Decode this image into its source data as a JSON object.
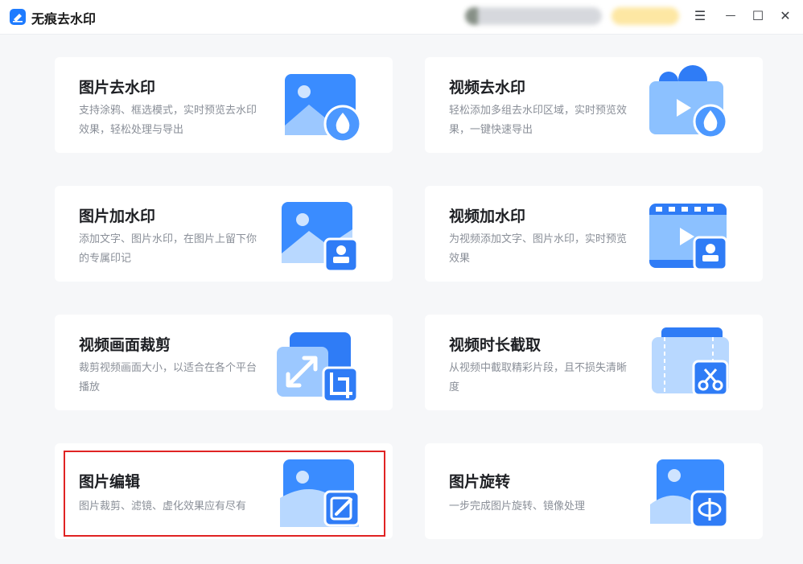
{
  "app": {
    "title": "无痕去水印"
  },
  "window": {
    "menu_glyph": "☰",
    "min_glyph": "—",
    "max_glyph": "☐",
    "close_glyph": "✕"
  },
  "colors": {
    "accent": "#1e7bff",
    "highlight": "#e02323"
  },
  "cards": [
    {
      "title": "图片去水印",
      "desc": "支持涂鸦、框选模式，实时预览去水印效果，轻松处理与导出",
      "icon": "image-drop-icon"
    },
    {
      "title": "视频去水印",
      "desc": "轻松添加多组去水印区域，实时预览效果，一键快速导出",
      "icon": "video-drop-icon"
    },
    {
      "title": "图片加水印",
      "desc": "添加文字、图片水印，在图片上留下你的专属印记",
      "icon": "image-stamp-icon"
    },
    {
      "title": "视频加水印",
      "desc": "为视频添加文字、图片水印，实时预览效果",
      "icon": "video-stamp-icon"
    },
    {
      "title": "视频画面裁剪",
      "desc": "裁剪视频画面大小，以适合在各个平台播放",
      "icon": "video-crop-icon"
    },
    {
      "title": "视频时长截取",
      "desc": "从视频中截取精彩片段，且不损失清晰度",
      "icon": "video-cut-icon"
    },
    {
      "title": "图片编辑",
      "desc": "图片裁剪、滤镜、虚化效果应有尽有",
      "icon": "image-edit-icon"
    },
    {
      "title": "图片旋转",
      "desc": "一步完成图片旋转、镜像处理",
      "icon": "image-rotate-icon"
    }
  ]
}
